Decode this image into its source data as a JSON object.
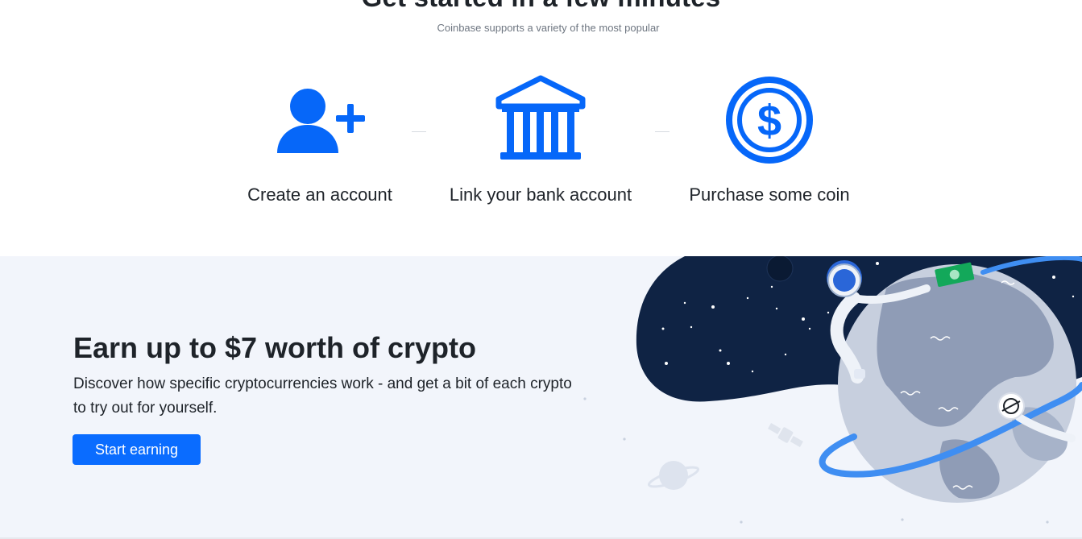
{
  "top": {
    "heading": "Get started in a few minutes",
    "subheading": "Coinbase supports a variety of the most popular",
    "steps": [
      {
        "label": "Create an account",
        "icon": "add-user-icon"
      },
      {
        "label": "Link your bank account",
        "icon": "bank-icon"
      },
      {
        "label": "Purchase some coin",
        "icon": "dollar-coin-icon"
      }
    ]
  },
  "promo": {
    "title": "Earn up to $7 worth of crypto",
    "description": "Discover how specific cryptocurrencies work - and get a bit of each crypto to try out for yourself.",
    "button_label": "Start earning",
    "illustration": "astronaut-planet-illustration"
  },
  "colors": {
    "accent": "#0a6cff",
    "icon_blue": "#0667f9",
    "promo_background": "#f2f5fb",
    "space_navy": "#0f2344",
    "text": "#1e2329"
  }
}
